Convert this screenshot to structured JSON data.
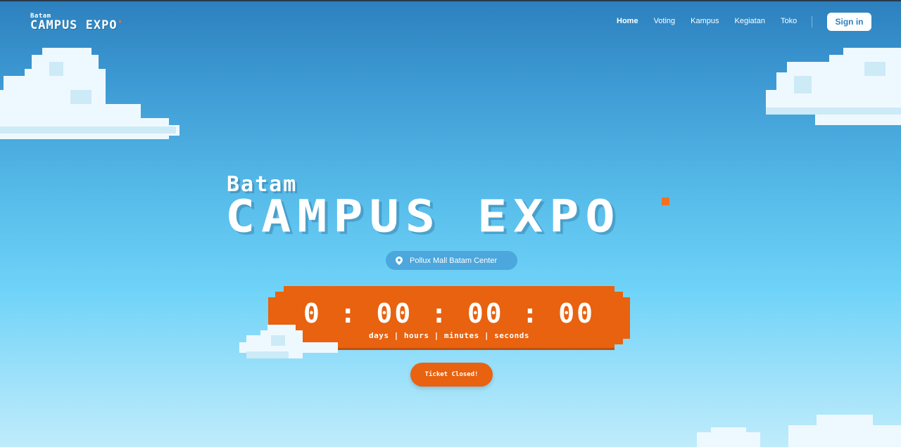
{
  "nav": {
    "brand_small": "Batam",
    "brand_big": "CAMPUS EXPO",
    "links": [
      "Home",
      "Voting",
      "Kampus",
      "Kegiatan",
      "Toko"
    ],
    "active_link": "Home",
    "signin_label": "Sign in"
  },
  "hero": {
    "title_small": "Batam",
    "title_big": "CAMPUS EXPO",
    "location": "Pollux Mall Batam Center",
    "location_icon": "map-pin-icon"
  },
  "countdown": {
    "value": "0 : 00 : 00 : 00",
    "labels": "days | hours | minutes | seconds"
  },
  "ticket_button": "Ticket Closed!",
  "colors": {
    "accent": "#e8620f",
    "sky_top": "#2c80bd",
    "sky_bottom": "#bfecfb",
    "signin_text": "#2c80bd"
  }
}
